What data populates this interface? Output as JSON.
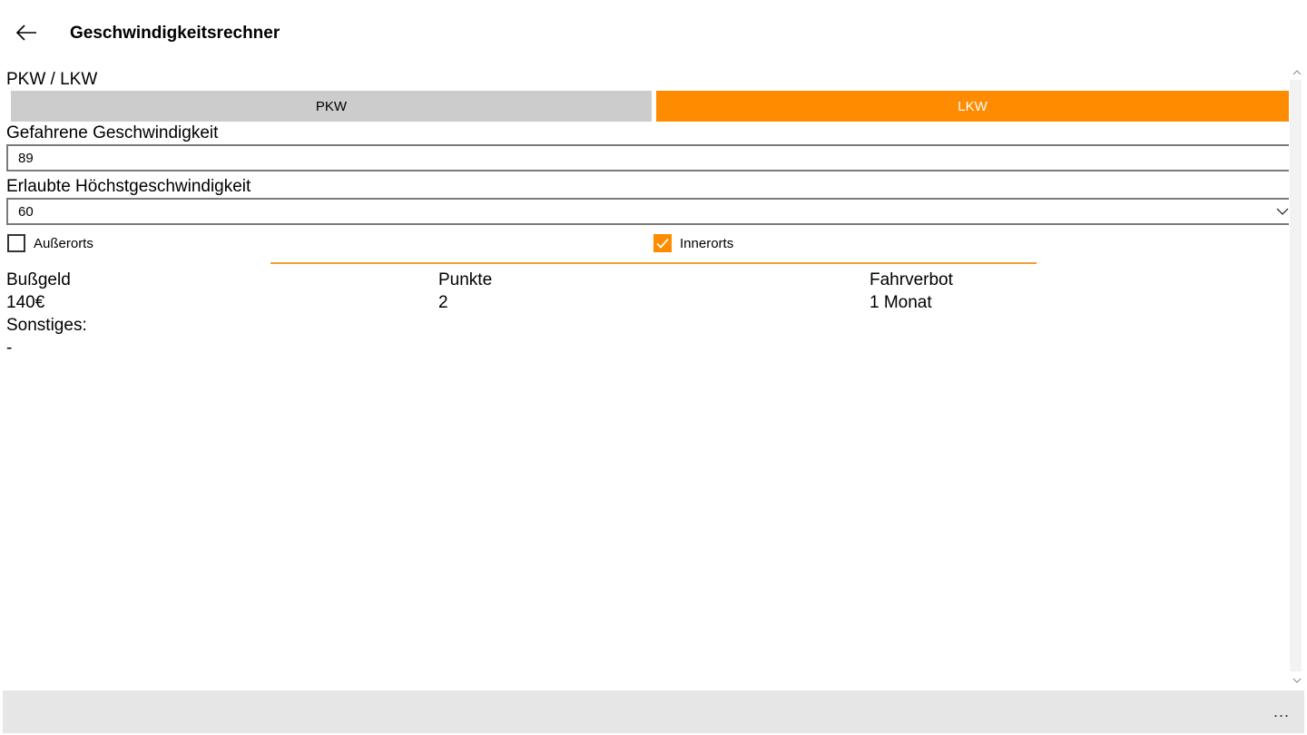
{
  "header": {
    "back_icon": "arrow-left-icon",
    "title": "Geschwindigkeitsrechner"
  },
  "vehicle": {
    "label": "PKW / LKW",
    "options": [
      "PKW",
      "LKW"
    ],
    "selected": "LKW",
    "accent": "#ff8c00",
    "inactive_color": "#cccccc"
  },
  "speed": {
    "label": "Gefahrene Geschwindigkeit",
    "value": "89"
  },
  "limit": {
    "label": "Erlaubte Höchstgeschwindigkeit",
    "value": "60",
    "chevron_icon": "chevron-down-icon"
  },
  "location": {
    "ausserorts": {
      "label": "Außerorts",
      "checked": false
    },
    "innerorts": {
      "label": "Innerorts",
      "checked": true
    }
  },
  "result": {
    "bussgeld": {
      "label": "Bußgeld",
      "value": "140€"
    },
    "punkte": {
      "label": "Punkte",
      "value": "2"
    },
    "fahrverbot": {
      "label": "Fahrverbot",
      "value": "1 Monat"
    },
    "sonstiges": {
      "label": "Sonstiges:",
      "value": "-"
    }
  },
  "appbar": {
    "more_label": "..."
  }
}
